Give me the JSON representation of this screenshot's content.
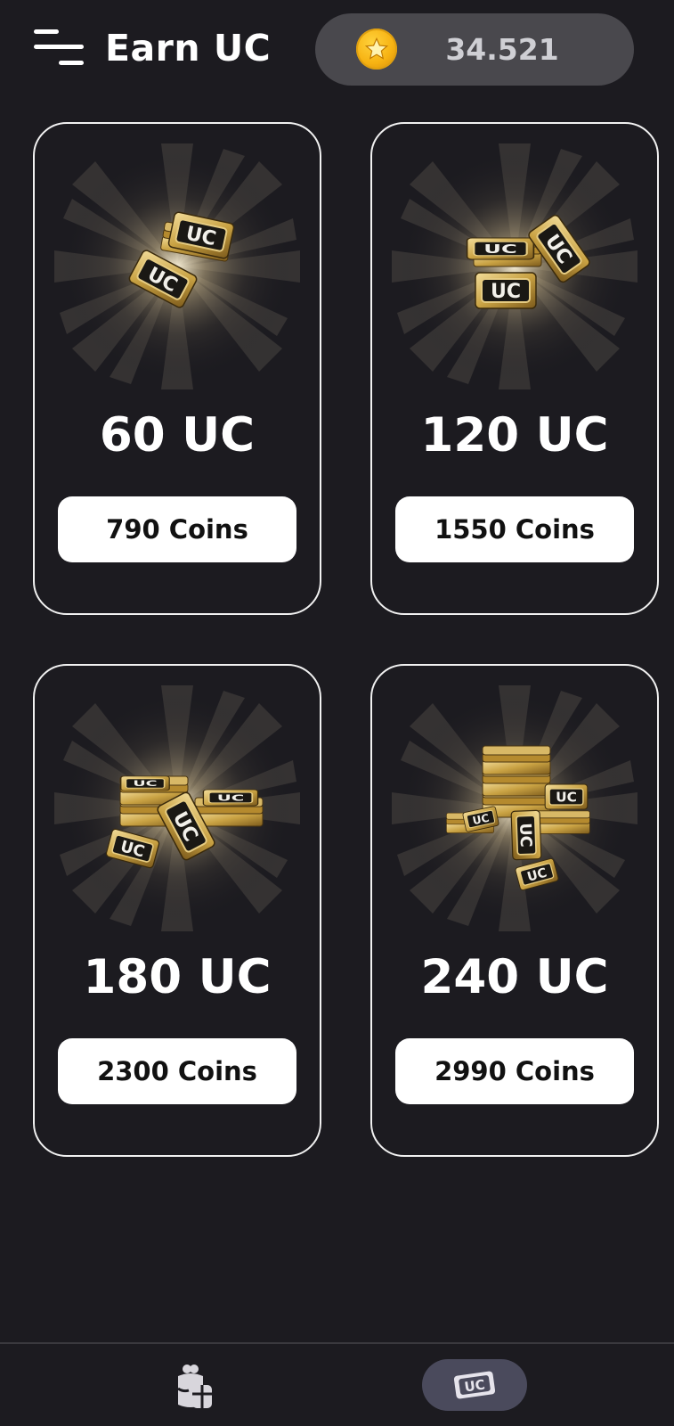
{
  "header": {
    "title": "Earn UC",
    "menu_icon": "hamburger-menu-icon",
    "balance": {
      "icon": "gold-coin-icon",
      "value": "34.521"
    }
  },
  "offers": [
    {
      "amount": "60 UC",
      "price": "790 Coins",
      "image": "uc-tickets-small-icon"
    },
    {
      "amount": "120 UC",
      "price": "1550 Coins",
      "image": "uc-tickets-box-icon"
    },
    {
      "amount": "180 UC",
      "price": "2300 Coins",
      "image": "uc-tickets-stack-icon"
    },
    {
      "amount": "240 UC",
      "price": "2990 Coins",
      "image": "uc-tickets-pile-icon"
    }
  ],
  "bottom_nav": {
    "items": [
      {
        "icon": "gifts-icon",
        "active": false
      },
      {
        "icon": "uc-ticket-icon",
        "label": "UC",
        "active": true
      }
    ]
  },
  "colors": {
    "background": "#1c1b20",
    "balance_pill": "#49484d",
    "coin": "#f7b313",
    "card_border": "#f1f1f1",
    "button": "#ffffff",
    "nav_active": "#4a4a5c",
    "gold": "#c9a243"
  }
}
